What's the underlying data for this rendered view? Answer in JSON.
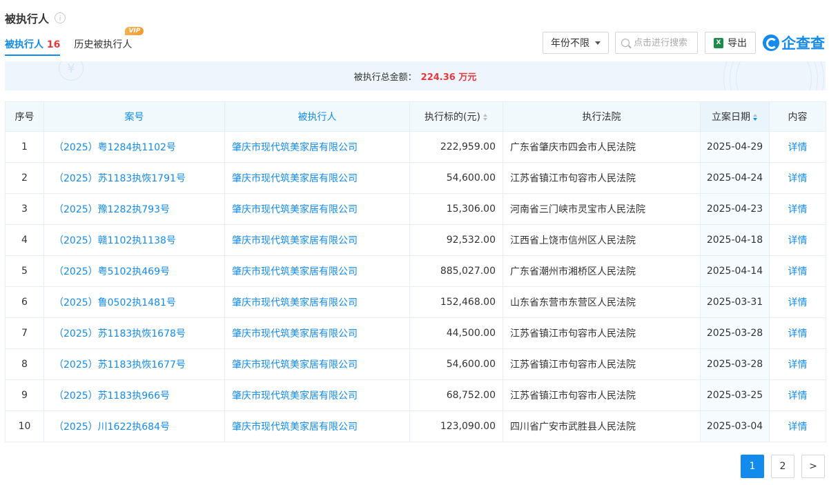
{
  "header": {
    "title": "被执行人",
    "info_icon": "ⓘ"
  },
  "tabs": [
    {
      "label": "被执行人",
      "count": "16"
    },
    {
      "label": "历史被执行人",
      "badge": "VIP"
    }
  ],
  "toolbar": {
    "year_filter": "年份不限",
    "search_placeholder": "点击进行搜索",
    "export_label": "导出",
    "brand_name": "企查查"
  },
  "summary": {
    "label": "被执行总金额：",
    "amount": "224.36 万元"
  },
  "table": {
    "headers": [
      "序号",
      "案号",
      "被执行人",
      "执行标的(元)",
      "执行法院",
      "立案日期",
      "内容"
    ],
    "rows": [
      {
        "idx": "1",
        "case": "（2025）粤1284执1102号",
        "party": "肇庆市现代筑美家居有限公司",
        "amount": "222,959.00",
        "court": "广东省肇庆市四会市人民法院",
        "date": "2025-04-29",
        "detail": "详情"
      },
      {
        "idx": "2",
        "case": "（2025）苏1183执恢1791号",
        "party": "肇庆市现代筑美家居有限公司",
        "amount": "54,600.00",
        "court": "江苏省镇江市句容市人民法院",
        "date": "2025-04-24",
        "detail": "详情"
      },
      {
        "idx": "3",
        "case": "（2025）豫1282执793号",
        "party": "肇庆市现代筑美家居有限公司",
        "amount": "15,306.00",
        "court": "河南省三门峡市灵宝市人民法院",
        "date": "2025-04-23",
        "detail": "详情"
      },
      {
        "idx": "4",
        "case": "（2025）赣1102执1138号",
        "party": "肇庆市现代筑美家居有限公司",
        "amount": "92,532.00",
        "court": "江西省上饶市信州区人民法院",
        "date": "2025-04-18",
        "detail": "详情"
      },
      {
        "idx": "5",
        "case": "（2025）粤5102执469号",
        "party": "肇庆市现代筑美家居有限公司",
        "amount": "885,027.00",
        "court": "广东省潮州市湘桥区人民法院",
        "date": "2025-04-14",
        "detail": "详情"
      },
      {
        "idx": "6",
        "case": "（2025）鲁0502执1481号",
        "party": "肇庆市现代筑美家居有限公司",
        "amount": "152,468.00",
        "court": "山东省东营市东营区人民法院",
        "date": "2025-03-31",
        "detail": "详情"
      },
      {
        "idx": "7",
        "case": "（2025）苏1183执恢1678号",
        "party": "肇庆市现代筑美家居有限公司",
        "amount": "44,500.00",
        "court": "江苏省镇江市句容市人民法院",
        "date": "2025-03-28",
        "detail": "详情"
      },
      {
        "idx": "8",
        "case": "（2025）苏1183执恢1677号",
        "party": "肇庆市现代筑美家居有限公司",
        "amount": "54,600.00",
        "court": "江苏省镇江市句容市人民法院",
        "date": "2025-03-28",
        "detail": "详情"
      },
      {
        "idx": "9",
        "case": "（2025）苏1183执966号",
        "party": "肇庆市现代筑美家居有限公司",
        "amount": "68,752.00",
        "court": "江苏省镇江市句容市人民法院",
        "date": "2025-03-25",
        "detail": "详情"
      },
      {
        "idx": "10",
        "case": "（2025）川1622执684号",
        "party": "肇庆市现代筑美家居有限公司",
        "amount": "123,090.00",
        "court": "四川省广安市武胜县人民法院",
        "date": "2025-03-04",
        "detail": "详情"
      }
    ]
  },
  "pagination": {
    "pages": [
      "1",
      "2"
    ],
    "current": "1",
    "next": ">"
  },
  "colors": {
    "accent": "#128bed",
    "amount_red": "#e4393c"
  }
}
